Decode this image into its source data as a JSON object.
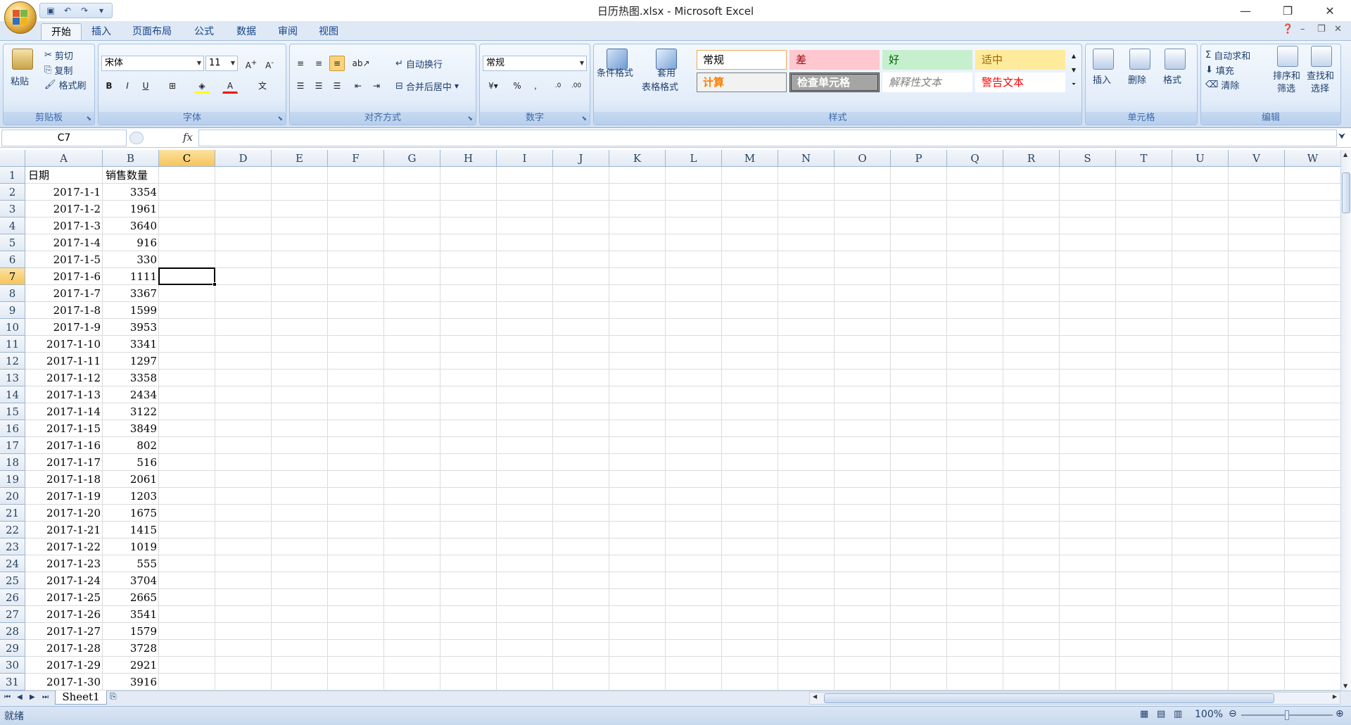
{
  "window": {
    "title": "日历热图.xlsx - Microsoft Excel",
    "controls": [
      "—",
      "❐",
      "✕"
    ]
  },
  "tabs": [
    {
      "label": "开始",
      "active": true
    },
    {
      "label": "插入"
    },
    {
      "label": "页面布局"
    },
    {
      "label": "公式"
    },
    {
      "label": "数据"
    },
    {
      "label": "审阅"
    },
    {
      "label": "视图"
    }
  ],
  "ribbon": {
    "clipboard": {
      "label": "剪贴板",
      "paste": "粘贴",
      "cut": "剪切",
      "copy": "复制",
      "format_painter": "格式刷"
    },
    "font": {
      "label": "字体",
      "name": "宋体",
      "size": "11"
    },
    "alignment": {
      "label": "对齐方式",
      "wrap": "自动换行",
      "merge": "合并后居中"
    },
    "number": {
      "label": "数字",
      "format": "常规"
    },
    "styles": {
      "label": "样式",
      "conditional": "条件格式",
      "table_format_1": "套用",
      "table_format_2": "表格格式",
      "cells": [
        "常规",
        "差",
        "好",
        "适中",
        "计算",
        "检查单元格",
        "解释性文本",
        "警告文本"
      ]
    },
    "cells": {
      "label": "单元格",
      "insert": "插入",
      "delete": "删除",
      "format": "格式"
    },
    "editing": {
      "label": "编辑",
      "autosum": "自动求和",
      "fill": "填充",
      "clear": "清除",
      "sort_1": "排序和",
      "sort_2": "筛选",
      "find_1": "查找和",
      "find_2": "选择"
    }
  },
  "formula_bar": {
    "name_box": "C7",
    "fx": "fx",
    "formula": ""
  },
  "columns": [
    "A",
    "B",
    "C",
    "D",
    "E",
    "F",
    "G",
    "H",
    "I",
    "J",
    "K",
    "L",
    "M",
    "N",
    "O",
    "P",
    "Q",
    "R",
    "S",
    "T",
    "U",
    "V",
    "W"
  ],
  "selected": {
    "col": "C",
    "row": 7
  },
  "rows": [
    [
      "日期",
      "销售数量"
    ],
    [
      "2017-1-1",
      "3354"
    ],
    [
      "2017-1-2",
      "1961"
    ],
    [
      "2017-1-3",
      "3640"
    ],
    [
      "2017-1-4",
      "916"
    ],
    [
      "2017-1-5",
      "330"
    ],
    [
      "2017-1-6",
      "1111"
    ],
    [
      "2017-1-7",
      "3367"
    ],
    [
      "2017-1-8",
      "1599"
    ],
    [
      "2017-1-9",
      "3953"
    ],
    [
      "2017-1-10",
      "3341"
    ],
    [
      "2017-1-11",
      "1297"
    ],
    [
      "2017-1-12",
      "3358"
    ],
    [
      "2017-1-13",
      "2434"
    ],
    [
      "2017-1-14",
      "3122"
    ],
    [
      "2017-1-15",
      "3849"
    ],
    [
      "2017-1-16",
      "802"
    ],
    [
      "2017-1-17",
      "516"
    ],
    [
      "2017-1-18",
      "2061"
    ],
    [
      "2017-1-19",
      "1203"
    ],
    [
      "2017-1-20",
      "1675"
    ],
    [
      "2017-1-21",
      "1415"
    ],
    [
      "2017-1-22",
      "1019"
    ],
    [
      "2017-1-23",
      "555"
    ],
    [
      "2017-1-24",
      "3704"
    ],
    [
      "2017-1-25",
      "2665"
    ],
    [
      "2017-1-26",
      "3541"
    ],
    [
      "2017-1-27",
      "1579"
    ],
    [
      "2017-1-28",
      "3728"
    ],
    [
      "2017-1-29",
      "2921"
    ],
    [
      "2017-1-30",
      "3916"
    ]
  ],
  "sheets": [
    "Sheet1"
  ],
  "status": {
    "ready": "就绪",
    "zoom": "100%"
  }
}
